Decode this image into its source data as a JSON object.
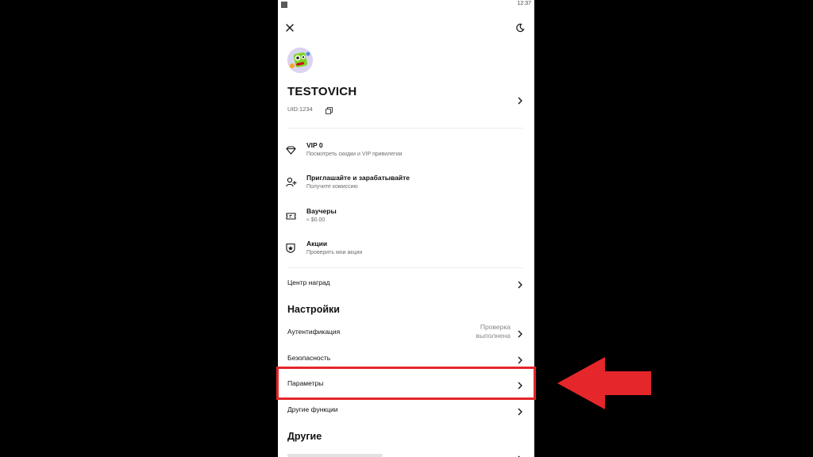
{
  "statusbar": {
    "time": "12:37"
  },
  "header": {
    "close_icon": "close-icon",
    "theme_icon": "moon-icon"
  },
  "profile": {
    "username": "TESTOVICH",
    "uid": "UID:1234"
  },
  "menu": [
    {
      "icon": "diamond-icon",
      "title": "VIP 0",
      "subtitle": "Посмотреть скидки и VIP привилегии"
    },
    {
      "icon": "add-user-icon",
      "title": "Приглашайте и зарабатывайте",
      "subtitle": "Получите комиссию"
    },
    {
      "icon": "ticket-icon",
      "title": "Ваучеры",
      "subtitle": "≈ $0.00"
    },
    {
      "icon": "shield-gift-icon",
      "title": "Акции",
      "subtitle": "Проверить мои акции"
    }
  ],
  "rewards_center": {
    "label": "Центр наград"
  },
  "settings": {
    "title": "Настройки",
    "items": [
      {
        "label": "Аутентификация",
        "status_line1": "Проверка",
        "status_line2": "выполнена"
      },
      {
        "label": "Безопасность"
      },
      {
        "label": "Параметры"
      },
      {
        "label": "Другие функции"
      }
    ]
  },
  "other": {
    "title": "Другие"
  },
  "colors": {
    "highlight": "#e5262a",
    "background": "#000000",
    "panel": "#ffffff"
  }
}
